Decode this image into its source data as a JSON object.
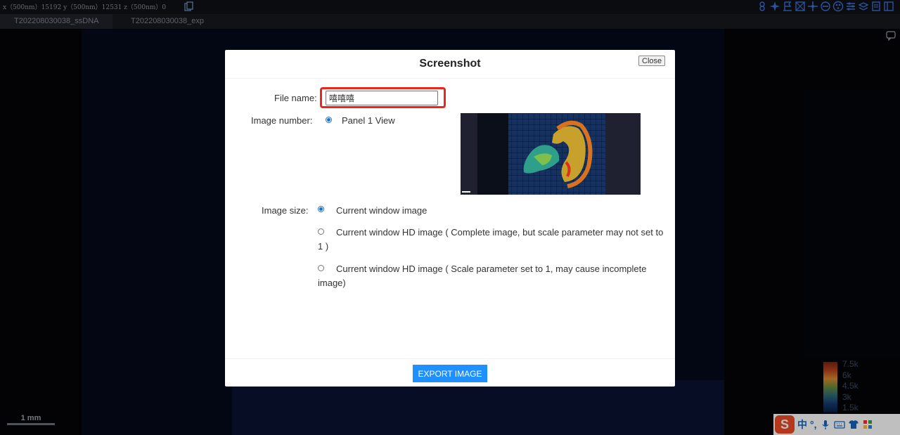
{
  "status_bar": {
    "coords": "x（500nm）15192   y（500nm）12531   z（500nm）0"
  },
  "tabs": [
    {
      "label": "T202208030038_ssDNA"
    },
    {
      "label": "T202208030038_exp"
    }
  ],
  "toolbar_icons": [
    "lasso-icon",
    "compass-icon",
    "flag-icon",
    "grid-select-icon",
    "crosshair-icon",
    "no-entry-icon",
    "palette-icon",
    "sliders-icon",
    "layers-icon",
    "document-icon",
    "panel-icon"
  ],
  "scalebar": {
    "label": "1 mm"
  },
  "colorbar": {
    "labels": [
      "7.5k",
      "6k",
      "4.5k",
      "3k",
      "1.5k"
    ],
    "colors": [
      "#7a2410",
      "#d98a2e",
      "#2b6a7a",
      "#0a1a40"
    ]
  },
  "ime": {
    "logo": "S",
    "lang": "中",
    "punct": "°,"
  },
  "modal": {
    "title": "Screenshot",
    "close_label": "Close",
    "file_name": {
      "label": "File name:",
      "value": "嘻嘻嘻"
    },
    "image_number": {
      "label": "Image number:",
      "option": "Panel 1 View",
      "selected": true
    },
    "image_size": {
      "label": "Image size:",
      "options": [
        {
          "label": "Current window image",
          "selected": true
        },
        {
          "label": "Current window HD image ( Complete image, but scale parameter may not set to 1 )",
          "selected": false
        },
        {
          "label": "Current window HD image ( Scale parameter set to 1, may cause incomplete image)",
          "selected": false
        }
      ]
    },
    "export_label": "EXPORT IMAGE"
  },
  "colors": {
    "accent": "#1e90ff",
    "highlight": "#e8281f",
    "radio": "#1f6fd1"
  }
}
